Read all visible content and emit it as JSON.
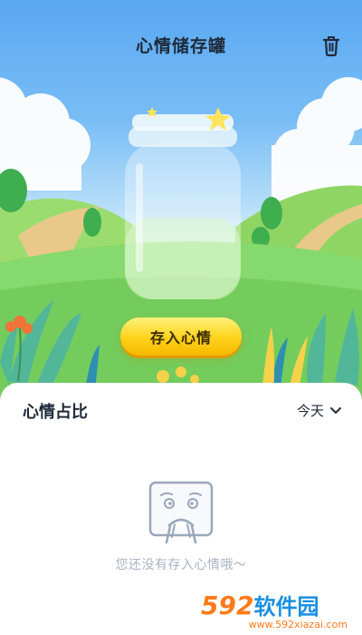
{
  "header": {
    "title": "心情储存罐",
    "trash_icon": "trash-icon"
  },
  "hero": {
    "store_button_label": "存入心情"
  },
  "panel": {
    "title": "心情占比",
    "period_label": "今天",
    "period_icon": "chevron-down-icon",
    "empty_message": "您还没有存入心情哦～",
    "empty_icon": "sad-face-box-icon"
  },
  "watermark": {
    "brand_number": "592",
    "brand_text": "软件园",
    "url": "www.592xiazai.com"
  },
  "colors": {
    "accent_yellow": "#ffd21a",
    "sky_blue": "#5aa8f2",
    "grass_green": "#7fd36a",
    "watermark_orange": "#ff7a1a"
  }
}
